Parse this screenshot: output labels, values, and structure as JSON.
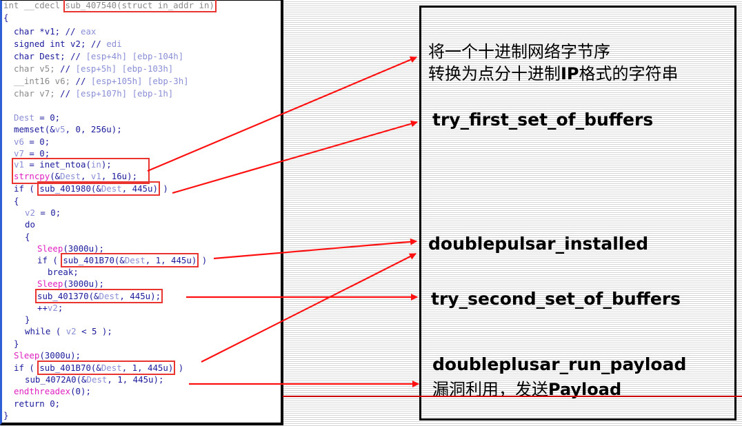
{
  "code": {
    "signature_prefix": "int __cdecl ",
    "signature_func": "sub_407540(struct in_addr in)",
    "lines": {
      "open_brace": "{",
      "decl_v1": "char *v1;",
      "decl_v1_cmt": " // ",
      "decl_v1_reg": "eax",
      "decl_v2": "signed int v2;",
      "decl_v2_cmt": " // ",
      "decl_v2_reg": "edi",
      "decl_dest": "char Dest;",
      "decl_dest_cmt": " // ",
      "decl_dest_reg": "[esp+4h] [ebp-104h]",
      "decl_v5": "char v5;",
      "decl_v5_cmt": " // ",
      "decl_v5_reg": "[esp+5h] [ebp-103h]",
      "decl_v6": "__int16 v6;",
      "decl_v6_cmt": " // ",
      "decl_v6_reg": "[esp+105h] [ebp-3h]",
      "decl_v7": "char v7;",
      "decl_v7_cmt": " // ",
      "decl_v7_reg": "[esp+107h] [ebp-1h]",
      "dest_zero_var": "Dest",
      "dest_zero_rest": " = 0;",
      "memset_a": "memset(&",
      "memset_var": "v5",
      "memset_b": ", 0, 256u);",
      "v6_var": "v6",
      "v6_rest": " = 0;",
      "v7_var": "v7",
      "v7_rest": " = 0;",
      "inet_var": "v1",
      "inet_rest": " = inet_ntoa(",
      "inet_arg": "in",
      "inet_end": ");",
      "strncpy_fn": "strncpy",
      "strncpy_a": "(&",
      "strncpy_dest": "Dest",
      "strncpy_b": ", ",
      "strncpy_v1": "v1",
      "strncpy_c": ", 16u);",
      "if1_a": "if ( ",
      "if1_call_a": "sub_401980(&",
      "if1_call_dest": "Dest",
      "if1_call_b": ", 445u)",
      "if1_end": " )",
      "brace2": "{",
      "v2_var": "v2",
      "v2_rest": " = 0;",
      "do": "do",
      "brace3": "{",
      "sleep1_fn": "Sleep",
      "sleep1_rest": "(3000u);",
      "if2_a": "if ( ",
      "if2_call_a": "sub_401B70(&",
      "if2_call_dest": "Dest",
      "if2_call_b": ", 1, 445u)",
      "if2_end": " )",
      "break": "break;",
      "sleep2_fn": "Sleep",
      "sleep2_rest": "(3000u);",
      "sub1370_a": "sub_401370(&",
      "sub1370_dest": "Dest",
      "sub1370_b": ", 445u);",
      "incr_a": "++",
      "incr_var": "v2",
      "incr_b": ";",
      "close3": "}",
      "while_a": "while ( ",
      "while_var": "v2",
      "while_b": " < 5 );",
      "close2": "}",
      "sleep3_fn": "Sleep",
      "sleep3_rest": "(3000u);",
      "if3_a": "if ( ",
      "if3_call_a": "sub_401B70(&",
      "if3_call_dest": "Dest",
      "if3_call_b": ", 1, 445u)",
      "if3_end": " )",
      "sub72a0_a": "sub_4072A0(&",
      "sub72a0_dest": "Dest",
      "sub72a0_b": ", 1, 445u);",
      "endthread_fn": "endthreadex",
      "endthread_rest": "(0);",
      "return": "return 0;",
      "close1": "}"
    }
  },
  "descriptions": {
    "inet_ntoa_line1": "将一个十进制网络字节序",
    "inet_ntoa_line2_a": "转换为点分十进制",
    "inet_ntoa_line2_b": "IP",
    "inet_ntoa_line2_c": "格式的字符串",
    "try_first": "try_first_set_of_buffers",
    "doublepulsar_installed": "doublepulsar_installed",
    "try_second": "try_second_set_of_buffers",
    "run_payload": "doubleplusar_run_payload",
    "run_payload_cn_a": "漏洞利用，发送",
    "run_payload_cn_b": "Payload"
  },
  "colors": {
    "arrow": "#ff1010",
    "underline": "#cc0000",
    "highlight_box": "#e8332e"
  }
}
